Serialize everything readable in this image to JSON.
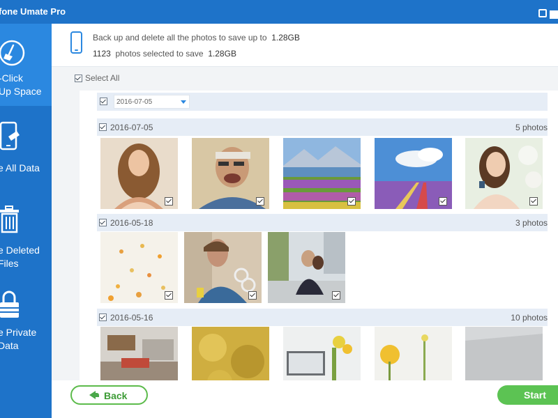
{
  "app": {
    "title": "fone Umate Pro"
  },
  "sidebar": {
    "items": [
      {
        "label": "-Click\nUp Space",
        "icon": "broom-icon",
        "active": true
      },
      {
        "label": "e All Data",
        "icon": "phone-erase-icon",
        "active": false
      },
      {
        "label": "e Deleted\nFiles",
        "icon": "trash-icon",
        "active": false
      },
      {
        "label": "e Private\nData",
        "icon": "lock-icon",
        "active": false
      }
    ]
  },
  "info": {
    "line1_prefix": "Back up and delete all the photos to save up to",
    "line1_value": "1.28GB",
    "line2_count": "1123",
    "line2_mid": "photos selected to save",
    "line2_value": "1.28GB"
  },
  "select_all_label": "Select All",
  "date_filter": {
    "value": "2016-07-05"
  },
  "groups": [
    {
      "date": "2016-07-05",
      "count": "5 photos"
    },
    {
      "date": "2016-05-18",
      "count": "3 photos"
    },
    {
      "date": "2016-05-16",
      "count": "10 photos"
    }
  ],
  "buttons": {
    "back": "Back",
    "start": "Start"
  },
  "colors": {
    "accent": "#1e73c9",
    "sidebar_active": "#2b88e0",
    "green": "#5cc353"
  }
}
